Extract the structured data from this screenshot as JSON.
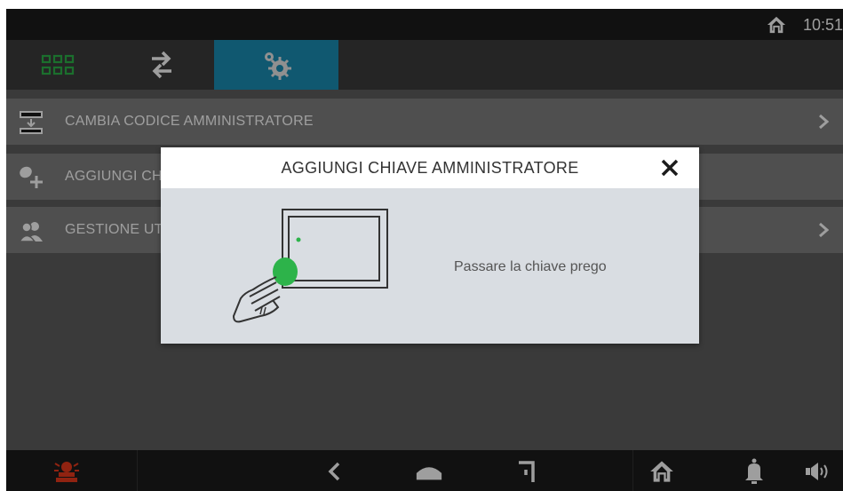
{
  "status_bar": {
    "time": "10:51",
    "home_icon": "home-icon"
  },
  "tabs": [
    {
      "name": "apps",
      "icon": "grid-icon",
      "active": false
    },
    {
      "name": "transfer",
      "icon": "transfer-arrows-icon",
      "active": false
    },
    {
      "name": "settings",
      "icon": "gears-icon",
      "active": true
    }
  ],
  "menu": {
    "items": [
      {
        "label": "CAMBIA CODICE AMMINISTRATORE",
        "icon": "keypad-icon"
      },
      {
        "label": "AGGIUNGI CHIAVE AMMINISTRATORE",
        "icon": "key-add-icon"
      },
      {
        "label": "GESTIONE UTENTI",
        "icon": "users-icon"
      }
    ]
  },
  "dialog": {
    "title": "AGGIUNGI CHIAVE AMMINISTRATORE",
    "message": "Passare la chiave prego",
    "illustration": "hand-key-reader-icon"
  },
  "nav_bar": {
    "alarm": "alarm-siren-icon",
    "back": "back-icon",
    "home": "home-icon",
    "recent": "recent-icon",
    "home_right": "home-icon",
    "bell": "bell-icon",
    "volume": "volume-icon"
  },
  "colors": {
    "accent": "#1b8fb5",
    "green": "#2db34a",
    "alarm": "#e8391c"
  }
}
